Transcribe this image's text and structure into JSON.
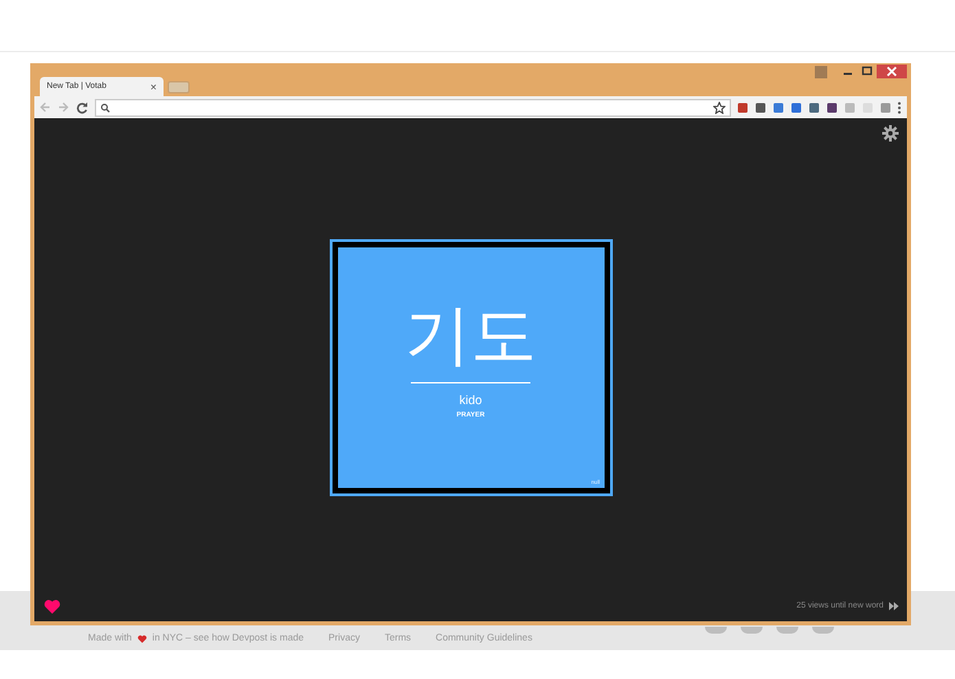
{
  "browser": {
    "tabs": [
      {
        "label": "New Tab | Votab",
        "close": "×",
        "selected": true
      }
    ],
    "extensions": [
      {
        "color": "#c0392b"
      },
      {
        "color": "#555555"
      },
      {
        "color": "#3b7bd6"
      },
      {
        "color": "#2f6fd8"
      },
      {
        "color": "#4d6a7f"
      },
      {
        "color": "#5b3a6b"
      },
      {
        "color": "#bbbbbb"
      },
      {
        "color": "#dddddd"
      },
      {
        "color": "#9a9a9a"
      }
    ]
  },
  "card": {
    "word": "기도",
    "romanization": "kido",
    "meaning": "PRAYER",
    "note": "null"
  },
  "views_until_new_word": "25 views until new word",
  "footer": {
    "made_with": "Made with",
    "made_in": "in NYC – see how Devpost is made",
    "links": [
      "Privacy",
      "Terms",
      "Community Guidelines"
    ]
  }
}
